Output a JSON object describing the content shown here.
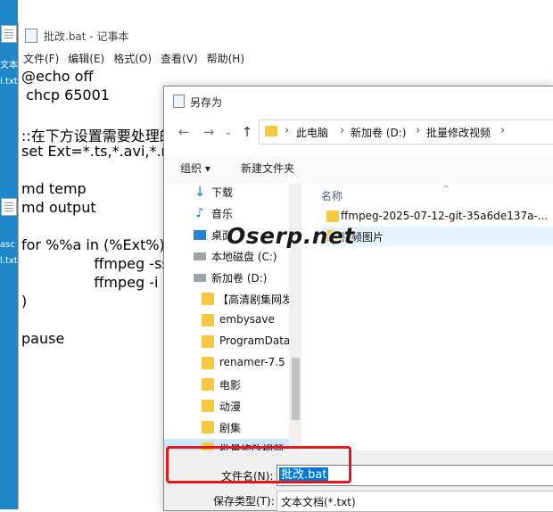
{
  "desktop": {
    "items": [
      {
        "label": "文本",
        "label2": "i.txt"
      },
      {
        "label": "asc",
        "label2": "l.txt"
      }
    ]
  },
  "notepad": {
    "title": "批改.bat - 记事本",
    "menu": [
      "文件(F)",
      "编辑(E)",
      "格式(O)",
      "查看(V)",
      "帮助(H)"
    ],
    "lines": [
      "@echo off",
      " chcp 65001",
      "",
      "::在下方设置需要处理的",
      "set Ext=*.ts,*.avi,*.mp",
      "",
      "md temp",
      "md output",
      "",
      "for %%a in (%Ext%) d",
      "                ffmpeg -ss",
      "                ffmpeg -i \"",
      ")",
      "",
      "pause"
    ]
  },
  "dialog": {
    "title": "另存为",
    "nav": {
      "back": "←",
      "forward": "→",
      "dropdown": "⌄",
      "up": "↑"
    },
    "address": [
      "此电脑",
      "新加卷 (D:)",
      "批量修改视频"
    ],
    "address_sep": "›",
    "toolbar": {
      "organize": "组织 ▾",
      "new_folder": "新建文件夹"
    },
    "nav_items": [
      {
        "label": "下载",
        "icon": "download"
      },
      {
        "label": "音乐",
        "icon": "music"
      },
      {
        "label": "桌面",
        "icon": "desktop"
      },
      {
        "label": "本地磁盘 (C:)",
        "icon": "drive"
      },
      {
        "label": "新加卷 (D:)",
        "icon": "drive"
      },
      {
        "label": "【高清剧集网发",
        "icon": "folder"
      },
      {
        "label": "embysave",
        "icon": "folder"
      },
      {
        "label": "ProgramData",
        "icon": "folder"
      },
      {
        "label": "renamer-7.5",
        "icon": "folder"
      },
      {
        "label": "电影",
        "icon": "folder"
      },
      {
        "label": "动漫",
        "icon": "folder"
      },
      {
        "label": "剧集",
        "icon": "folder"
      },
      {
        "label": "批量修改视频",
        "icon": "folder"
      }
    ],
    "column_header": "名称",
    "column_sort": "^",
    "files": [
      "ffmpeg-2025-07-12-git-35a6de137a-...",
      "视频图片"
    ],
    "filename_label": "文件名(N):",
    "filename_value": "批改.bat",
    "filetype_label": "保存类型(T):",
    "filetype_value": "文本文档(*.txt)"
  },
  "watermark": "Oserp.net",
  "colors": {
    "accent": "#0078d7",
    "highlight": "#e31919",
    "folder": "#f5c842"
  }
}
